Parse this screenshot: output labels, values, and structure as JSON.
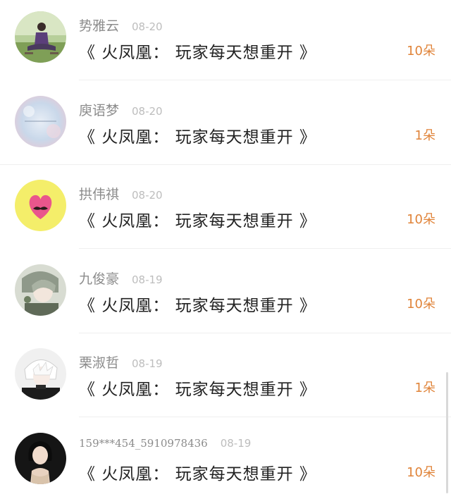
{
  "items": [
    {
      "name": "势雅云",
      "time": "08-20",
      "title": "《 火凤凰： 玩家每天想重开 》",
      "count": "10朵"
    },
    {
      "name": "庾语梦",
      "time": "08-20",
      "title": "《 火凤凰： 玩家每天想重开 》",
      "count": "1朵"
    },
    {
      "name": "拱伟祺",
      "time": "08-20",
      "title": "《 火凤凰： 玩家每天想重开 》",
      "count": "10朵"
    },
    {
      "name": "九俊豪",
      "time": "08-19",
      "title": "《 火凤凰： 玩家每天想重开 》",
      "count": "10朵"
    },
    {
      "name": "栗淑哲",
      "time": "08-19",
      "title": "《 火凤凰： 玩家每天想重开 》",
      "count": "1朵"
    },
    {
      "name": "159***454_5910978436",
      "time": "08-19",
      "title": "《 火凤凰： 玩家每天想重开 》",
      "count": "10朵"
    }
  ],
  "colors": {
    "name": "#8c8c8c",
    "time": "#bdbdbd",
    "title": "#222222",
    "count": "#e0843a"
  }
}
